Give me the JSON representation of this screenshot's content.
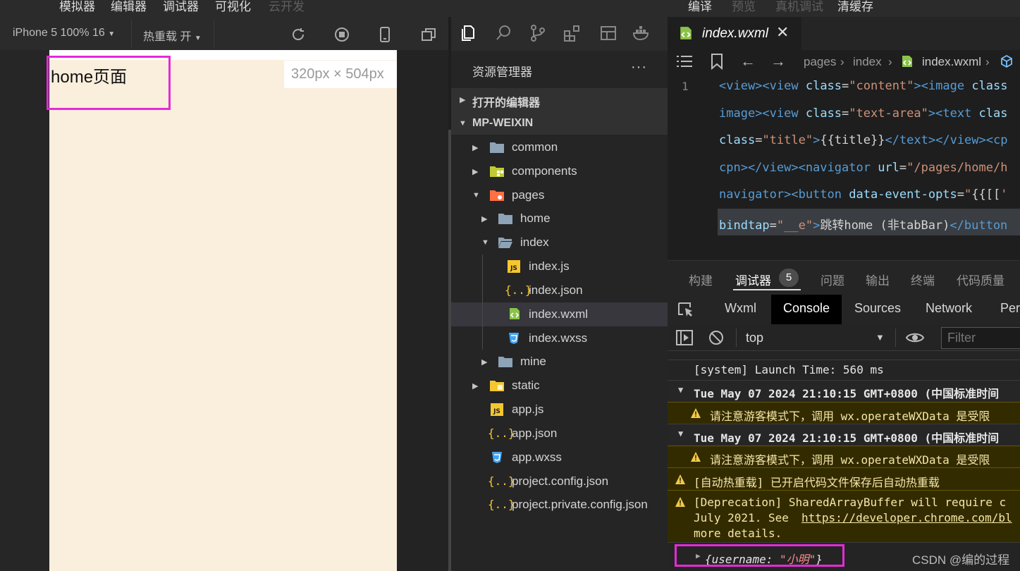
{
  "menu": {
    "items": [
      {
        "label": "模拟器",
        "enabled": true
      },
      {
        "label": "编辑器",
        "enabled": true
      },
      {
        "label": "调试器",
        "enabled": true
      },
      {
        "label": "可视化",
        "enabled": true
      },
      {
        "label": "云开发",
        "enabled": false
      }
    ],
    "right_items": [
      {
        "label": "编译",
        "enabled": true
      },
      {
        "label": "预览",
        "enabled": false
      },
      {
        "label": "真机调试",
        "enabled": false
      },
      {
        "label": "清缓存",
        "enabled": true
      }
    ]
  },
  "simulator": {
    "device_select": "iPhone 5 100% 16",
    "hot_reload": "热重载 开",
    "page_text": "home页面",
    "size_label": "320px × 504px"
  },
  "explorer": {
    "title": "资源管理器",
    "more": "···",
    "open_editors": "打开的编辑器",
    "root": "MP-WEIXIN",
    "tree": {
      "common": "common",
      "components": "components",
      "pages": "pages",
      "home": "home",
      "index": "index",
      "index_js": "index.js",
      "index_json": "index.json",
      "index_wxml": "index.wxml",
      "index_wxss": "index.wxss",
      "mine": "mine",
      "static": "static",
      "app_js": "app.js",
      "app_json": "app.json",
      "app_wxss": "app.wxss",
      "project_config": "project.config.json",
      "project_private_config": "project.private.config.json"
    }
  },
  "editor": {
    "tab": "index.wxml",
    "breadcrumb": [
      "pages",
      "index",
      "index.wxml"
    ],
    "line_number": "1"
  },
  "panel": {
    "tabs": [
      "构建",
      "调试器",
      "问题",
      "输出",
      "终端",
      "代码质量"
    ],
    "badge": "5",
    "devtools_tabs": [
      "Wxml",
      "Console",
      "Sources",
      "Network",
      "Perf"
    ],
    "context": "top",
    "filter_placeholder": "Filter"
  },
  "console": {
    "launch": "[system] Launch Time: 560 ms",
    "group1": "Tue May 07 2024 21:10:15 GMT+0800 (中国标准时间",
    "warn1": "请注意游客模式下，调用 wx.operateWXData 是受限",
    "group2": "Tue May 07 2024 21:10:15 GMT+0800 (中国标准时间",
    "warn2": "请注意游客模式下，调用 wx.operateWXData 是受限",
    "hot_reload": "[自动热重载] 已开启代码文件保存后自动热重载",
    "deprecation_line1": "[Deprecation] SharedArrayBuffer will require c",
    "deprecation_line2a": "July 2021. See ",
    "deprecation_link": "https://developer.chrome.com/bl",
    "deprecation_line3": "more details.",
    "object_open": "{",
    "object_key": "username",
    "object_colon": ": ",
    "object_value": "\"小明\"",
    "object_close": "}"
  },
  "watermark": "CSDN @编的过程",
  "colors": {
    "highlight_box": "#e52ad8",
    "page_bg": "#faeedd",
    "tag": "#569cd6",
    "attr": "#9cdcfe",
    "string": "#ce9178",
    "warning": "#f2c94c"
  }
}
